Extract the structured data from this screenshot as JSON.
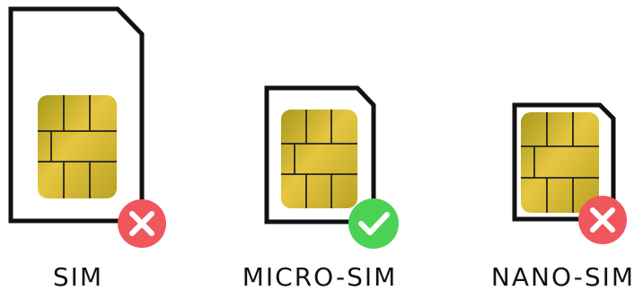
{
  "cards": [
    {
      "label": "SIM",
      "status": "incompatible",
      "status_icon": "cross-icon"
    },
    {
      "label": "MICRO-SIM",
      "status": "compatible",
      "status_icon": "check-icon"
    },
    {
      "label": "NANO-SIM",
      "status": "incompatible",
      "status_icon": "cross-icon"
    }
  ],
  "colors": {
    "outline": "#111111",
    "chip_light": "#e6c640",
    "chip_dark": "#a89a1c",
    "chip_line": "#222222",
    "cross_badge": "#f0575d",
    "check_badge": "#4bd153",
    "badge_mark": "#ffffff"
  }
}
